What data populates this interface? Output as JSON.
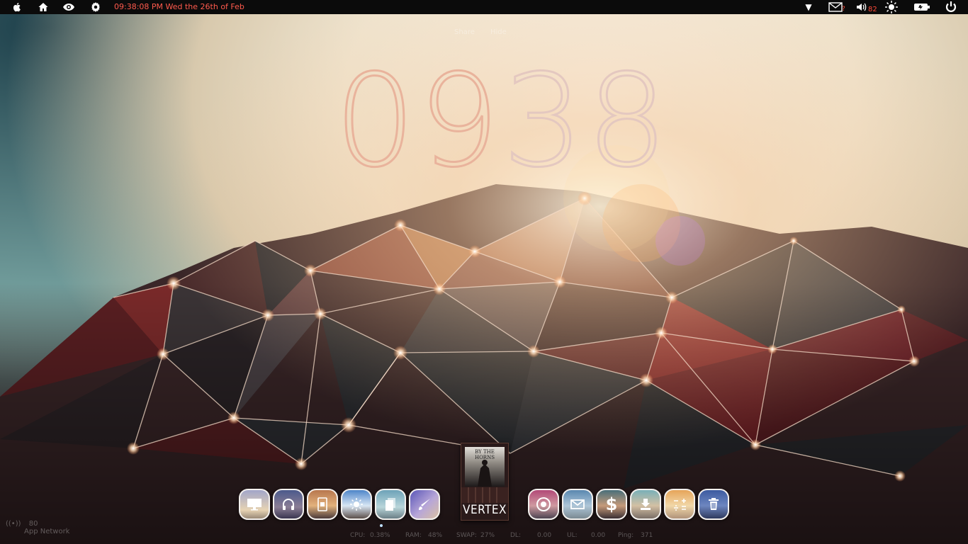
{
  "menubar": {
    "icons": [
      "apple-icon",
      "home-icon",
      "eye-icon",
      "gear-icon"
    ],
    "clock_text": "09:38:08 PM Wed the 26th of Feb",
    "mail_badge": "?",
    "volume_level": "82"
  },
  "clock": {
    "hours": "09",
    "minutes": "38",
    "links": [
      "Share",
      "Hide"
    ]
  },
  "album": {
    "band_text": "BY THE HORNS",
    "title": "VERTEX"
  },
  "dock": {
    "left_apps": [
      "monitor",
      "headphones",
      "phone",
      "weather",
      "files",
      "brush"
    ],
    "right_apps": [
      "disc",
      "mail",
      "money",
      "download",
      "calculator",
      "trash"
    ]
  },
  "stats": {
    "cpu_label": "CPU:",
    "cpu_value": "0.38%",
    "ram_label": "RAM:",
    "ram_value": "48%",
    "swap_label": "SWAP:",
    "swap_value": "27%",
    "dl_label": "DL:",
    "dl_value": "0.00",
    "ul_label": "UL:",
    "ul_value": "0.00",
    "ping_label": "Ping:",
    "ping_value": "371"
  },
  "network": {
    "value": "80",
    "label": "App Network"
  },
  "colors": {
    "accent": "#ff5a4d",
    "clock_stroke": "#e9b39c"
  }
}
